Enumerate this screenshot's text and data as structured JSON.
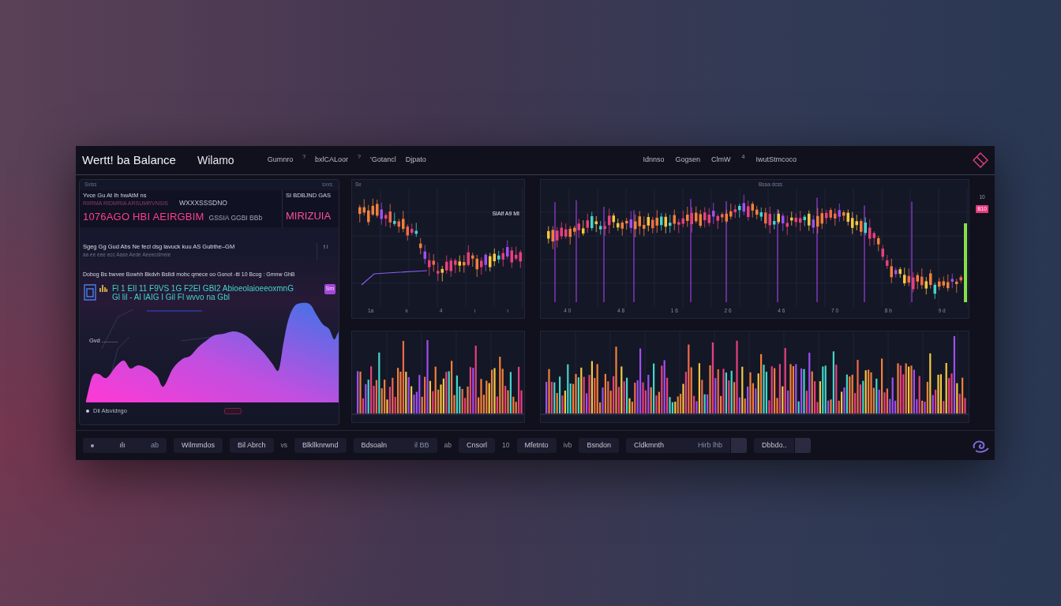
{
  "header": {
    "title": "Wertt! ba Balance",
    "account": "Wilamo",
    "nav_left": [
      {
        "kind": "link",
        "label": "Gumnro"
      },
      {
        "kind": "mark",
        "label": "?"
      },
      {
        "kind": "link",
        "label": "bxlCALoor"
      },
      {
        "kind": "mark",
        "label": "?"
      },
      {
        "kind": "link",
        "label": "'Gotancl"
      },
      {
        "kind": "link",
        "label": "Djpato"
      }
    ],
    "nav_right": [
      {
        "kind": "link",
        "label": "Idnnso"
      },
      {
        "kind": "link",
        "label": "Gogsen"
      },
      {
        "kind": "link",
        "label": "ClmW"
      },
      {
        "kind": "mark",
        "label": "4"
      },
      {
        "kind": "link",
        "label": "IwutStmcoco"
      }
    ]
  },
  "balance_panel": {
    "corner_labels": [
      "Sxlss",
      "sxxs"
    ],
    "caption": "Yvce Gu At Ih hwAtM ns",
    "subcaption": "RIIRMA RIDMRIA ARSUMRVNSIS",
    "tag": "WXXXSSSDNO",
    "side_caption": "SI BDBJND GAS",
    "amount": "1076AGO HBI AEIRGBIM",
    "amount_note": "GSSIA GGBI BBb",
    "side_amount": "MIRIZUIA",
    "summary": "Sgeg Gg Gud Abs Ne fecl dsg lavuck kuu AS Gubthe–GM",
    "summary_note": "aa ee eee ecc Aase  Aede Aeeecdmeie",
    "summary_side": "t i",
    "stats_row": "Dobog  Bs bwvee Bowhh  Bkdvh  Bslldi  mobc qmece oo  Gonot -tti 10  Bcog : Gmnw GhB",
    "ticker_lines": [
      "Fl 1 EIl 11 F9VS 1G F2EI GBI2 AbioeolaioeeoxmnG",
      "Gl lil - Al IAIG I Gil Fl  wvvo na Gbl"
    ],
    "badge": "Sm",
    "chart_label": "Gvd ..........",
    "footer": "Dii  Alsvidngo"
  },
  "price_charts": [
    {
      "label": "Sx",
      "marker": "SIAlf A9 MI",
      "x_ticks": [
        "1a",
        "ıı",
        "4",
        "ı",
        "ı"
      ]
    },
    {
      "label": "Bsaa dcss",
      "x_ticks": [
        "4 0",
        "4 8",
        "1 6",
        "2 6",
        "4 6",
        "7 0",
        "8 b",
        "9 d"
      ]
    }
  ],
  "price_axis": [
    {
      "text": "10",
      "highlight": false
    },
    {
      "text": "B10",
      "highlight": true
    }
  ],
  "toolbar": [
    {
      "kind": "dot_pill",
      "label": "ılı",
      "aside": "ab"
    },
    {
      "kind": "pill",
      "label": "Wilmmdos"
    },
    {
      "kind": "pill",
      "label": "Bil Abrch"
    },
    {
      "kind": "text",
      "label": "vs"
    },
    {
      "kind": "pill",
      "label": "Blkllknrwnd"
    },
    {
      "kind": "pill",
      "label": "Bdsoaln",
      "aside": "il BB"
    },
    {
      "kind": "text",
      "label": "ab"
    },
    {
      "kind": "pill",
      "label": "Cnsorl"
    },
    {
      "kind": "text",
      "label": "10"
    },
    {
      "kind": "pill",
      "label": "Mfetnto"
    },
    {
      "kind": "text",
      "label": "ivb"
    },
    {
      "kind": "pill",
      "label": "Bsndon"
    },
    {
      "kind": "split",
      "label": "Cldkmnth",
      "aside": "Hirb lhb"
    },
    {
      "kind": "split",
      "label": "Dbbdo.."
    }
  ]
}
